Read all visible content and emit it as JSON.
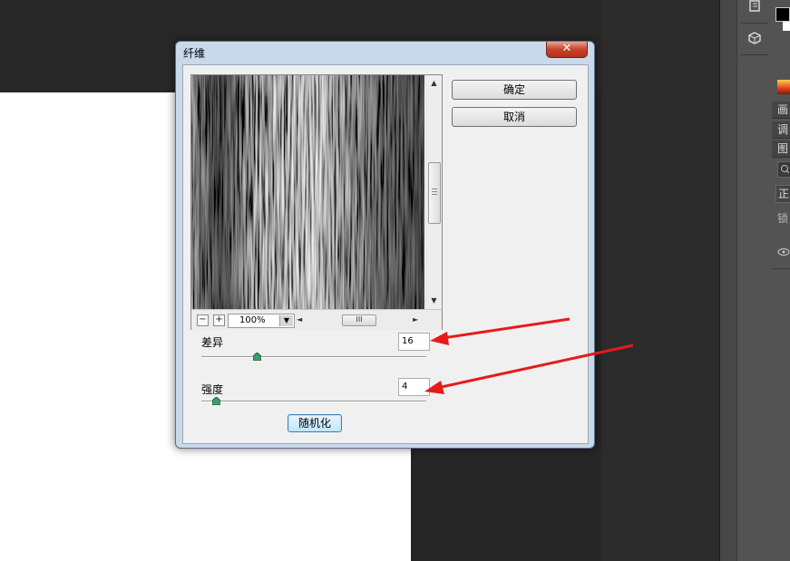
{
  "dialog": {
    "title": "纤维",
    "close_glyph": "✕",
    "ok_label": "确定",
    "cancel_label": "取消",
    "randomize_label": "随机化"
  },
  "preview": {
    "zoom_out_glyph": "−",
    "zoom_in_glyph": "+",
    "zoom_value": "100%",
    "dropdown_glyph": "▼",
    "scroll_up_glyph": "▲",
    "scroll_down_glyph": "▼",
    "scroll_left_glyph": "◄",
    "scroll_right_glyph": "►",
    "grip_glyph": "III"
  },
  "params": {
    "variance_label": "差异",
    "variance_value": "16",
    "variance_fraction": 0.24,
    "strength_label": "强度",
    "strength_value": "4",
    "strength_fraction": 0.05
  },
  "right_panel": {
    "tabs": [
      "画",
      "调",
      "图",
      "",
      "正",
      "锁",
      ""
    ],
    "tools": [
      "history-icon",
      "3d-icon"
    ]
  },
  "colors": {
    "annotation_arrow": "#e81a1a",
    "dialog_frame": "#c9d9ea",
    "workspace": "#282828",
    "close_button": "#c8422c"
  }
}
